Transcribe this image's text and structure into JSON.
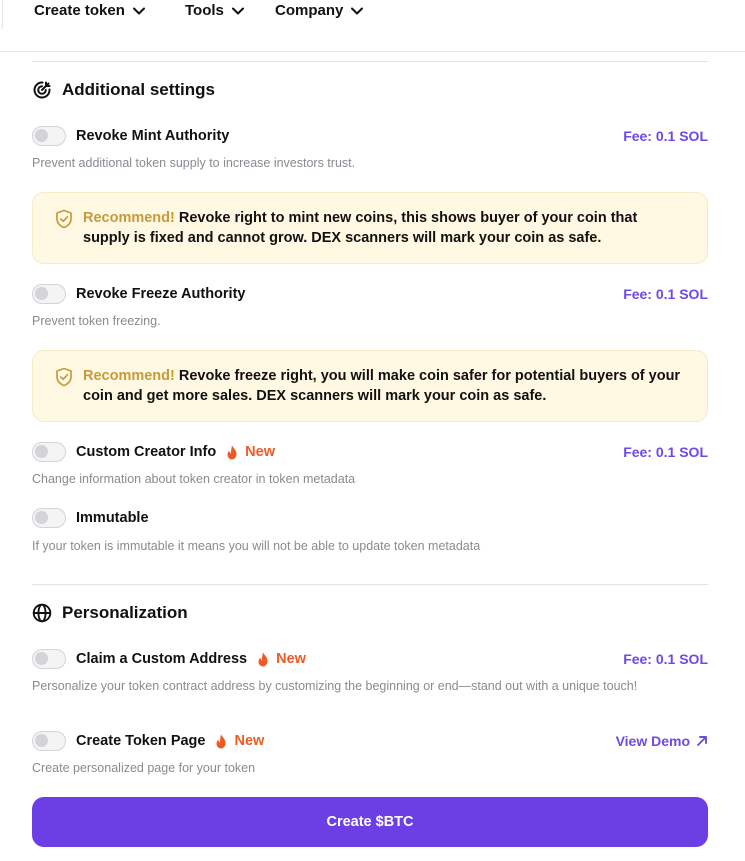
{
  "nav": {
    "create_token": "Create token",
    "tools": "Tools",
    "company": "Company"
  },
  "additional": {
    "title": "Additional settings",
    "items": [
      {
        "label": "Revoke Mint Authority",
        "fee": "Fee: 0.1 SOL",
        "desc": "Prevent additional token supply to increase investors trust.",
        "enabled": false
      },
      {
        "label": "Revoke Freeze Authority",
        "fee": "Fee: 0.1 SOL",
        "desc": "Prevent token freezing.",
        "enabled": false
      },
      {
        "label": "Custom Creator Info",
        "badge": "New",
        "fee": "Fee: 0.1 SOL",
        "desc": "Change information about token creator in token metadata",
        "enabled": false
      },
      {
        "label": "Immutable",
        "desc": "If your token is immutable it means you will not be able to update token metadata",
        "enabled": false
      }
    ],
    "recommend_mint": {
      "label": "Recommend!",
      "text": "Revoke right to mint new coins, this shows buyer of your coin that supply is fixed and cannot grow. DEX scanners will mark your coin as safe."
    },
    "recommend_freeze": {
      "label": "Recommend!",
      "text": "Revoke freeze right, you will make coin safer for potential buyers of your coin and get more sales. DEX scanners will mark your coin as safe."
    }
  },
  "personalization": {
    "title": "Personalization",
    "items": [
      {
        "label": "Claim a Custom Address",
        "badge": "New",
        "fee": "Fee: 0.1 SOL",
        "desc": "Personalize your token contract address by customizing the beginning or end—stand out with a unique touch!",
        "enabled": false
      },
      {
        "label": "Create Token Page",
        "badge": "New",
        "link": "View Demo",
        "desc": "Create personalized page for your token",
        "enabled": false
      }
    ]
  },
  "cta": {
    "label": "Create $BTC"
  },
  "colors": {
    "accent": "#6b3fe4",
    "fee": "#6e49e6",
    "new_badge": "#ef5a24",
    "recommend_bg": "#fff8e2",
    "recommend_label": "#c79a3a"
  },
  "icons": {
    "nav_chevron": "chevron-down-icon",
    "additional_settings": "target-arrow-icon",
    "personalization": "globe-icon",
    "recommend": "shield-check-icon",
    "new_badge": "fire-icon",
    "view_demo": "arrow-up-right-icon"
  }
}
